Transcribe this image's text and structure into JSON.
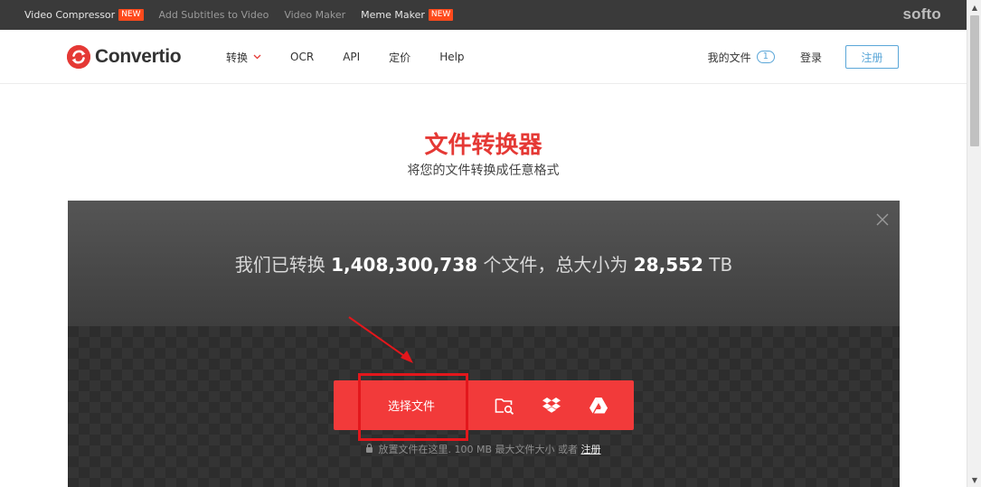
{
  "topbar": {
    "links": [
      {
        "label": "Video Compressor",
        "badge": "NEW",
        "bright": true
      },
      {
        "label": "Add Subtitles to Video",
        "badge": "",
        "bright": false
      },
      {
        "label": "Video Maker",
        "badge": "",
        "bright": false
      },
      {
        "label": "Meme Maker",
        "badge": "NEW",
        "bright": true
      }
    ],
    "brand": "softo"
  },
  "header": {
    "logo_text": "Convertio",
    "nav": [
      {
        "label": "转换",
        "has_dropdown": true
      },
      {
        "label": "OCR",
        "has_dropdown": false
      },
      {
        "label": "API",
        "has_dropdown": false
      },
      {
        "label": "定价",
        "has_dropdown": false
      },
      {
        "label": "Help",
        "has_dropdown": false
      }
    ],
    "my_files_label": "我的文件",
    "my_files_count": "1",
    "login_label": "登录",
    "register_label": "注册"
  },
  "hero": {
    "title": "文件转换器",
    "subtitle": "将您的文件转换成任意格式"
  },
  "converter": {
    "stats_prefix": "我们已转换 ",
    "files_count": "1,408,300,738",
    "stats_middle": " 个文件，总大小为 ",
    "total_size": "28,552",
    "size_unit": " TB",
    "choose_files_label": "选择文件",
    "hint_text": "放置文件在这里. 100 MB 最大文件大小 或者 ",
    "hint_register": "注册",
    "icons": [
      "folder-search-icon",
      "dropbox-icon",
      "google-drive-icon"
    ]
  },
  "colors": {
    "accent": "#e53935",
    "upload_bar": "#f23a3a",
    "link_blue": "#5aa6d8",
    "topbar_bg": "#3a3a3a",
    "annotation": "#e3171c"
  }
}
